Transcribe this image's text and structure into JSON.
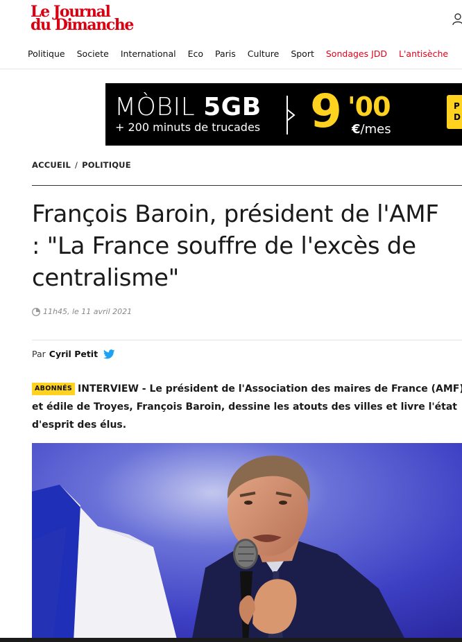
{
  "brand": {
    "logo_line1": "Le Journal",
    "logo_line2": "du Dimanche"
  },
  "nav": {
    "items": [
      "Politique",
      "Societe",
      "International",
      "Eco",
      "Paris",
      "Culture",
      "Sport"
    ],
    "highlight_items": [
      "Sondages JDD",
      "L'antisèche"
    ]
  },
  "ad": {
    "brand_light": "MÒBIL ",
    "brand_bold": "5GB",
    "subtitle": "+ 200 minuts de trucades",
    "price_main": "9",
    "price_cents": "'00",
    "price_currency": "€",
    "price_unit": "/mes",
    "side_text": "P D"
  },
  "breadcrumb": {
    "home": "ACCUEIL",
    "separator": "/",
    "section": "POLITIQUE"
  },
  "article": {
    "title": "François Baroin, président de l'AMF : \"La France souffre de l'excès de centralisme\"",
    "time": "11h45",
    "date": ", le 11 avril 2021",
    "author_prefix": "Par",
    "author": "Cyril Petit",
    "badge": "ABONNÉS",
    "lead": "INTERVIEW - Le président de l'Association des maires de France (AMF) et édile de Troyes, François Baroin, dessine les atouts des villes et livre l'état d'esprit des élus."
  },
  "colors": {
    "brand_red": "#d90012",
    "badge_yellow": "#ffd21f",
    "twitter_blue": "#1da1f2",
    "ad_yellow": "#ffd21f"
  },
  "icons": {
    "user": "user-icon",
    "clock": "clock-icon",
    "twitter": "twitter-icon"
  }
}
